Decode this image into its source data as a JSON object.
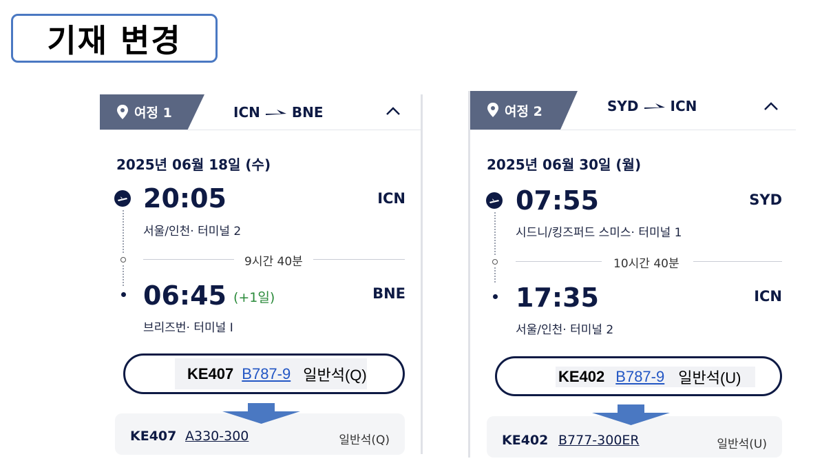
{
  "title": "기재 변경",
  "itineraries": [
    {
      "tab_label": "여정 1",
      "route_from": "ICN",
      "route_to": "BNE",
      "date": "2025년 06월 18일 (수)",
      "dep_time": "20:05",
      "dep_code": "ICN",
      "dep_terminal": "서울/인천· 터미널  2",
      "duration": "9시간 40분",
      "arr_time": "06:45",
      "arr_nextday": "(+1일)",
      "arr_code": "BNE",
      "arr_terminal": "브리즈번· 터미널  I",
      "old_flight": "KE407",
      "old_aircraft": "B787-9",
      "old_class": "일반석(Q)",
      "new_flight": "KE407",
      "new_aircraft": "A330-300",
      "new_class": "일반석(Q)"
    },
    {
      "tab_label": "여정 2",
      "route_from": "SYD",
      "route_to": "ICN",
      "date": "2025년 06월 30일 (월)",
      "dep_time": "07:55",
      "dep_code": "SYD",
      "dep_terminal": "시드니/킹즈퍼드 스미스· 터미널  1",
      "duration": "10시간 40분",
      "arr_time": "17:35",
      "arr_nextday": "",
      "arr_code": "ICN",
      "arr_terminal": "서울/인천· 터미널  2",
      "old_flight": "KE402",
      "old_aircraft": "B787-9",
      "old_class": "일반석(U)",
      "new_flight": "KE402",
      "new_aircraft": "B777-300ER",
      "new_class": "일반석(U)"
    }
  ],
  "icons": [
    "location-pin-icon",
    "plane-arrow-icon",
    "chevron-up-icon",
    "departure-icon",
    "down-arrow-icon"
  ],
  "colors": {
    "header_tab": "#5a6682",
    "navy": "#0e1a44",
    "link": "#2256c4",
    "next_day": "#2a8a3a",
    "title_border": "#4a78c2",
    "arrow_blue": "#4a78c2"
  }
}
